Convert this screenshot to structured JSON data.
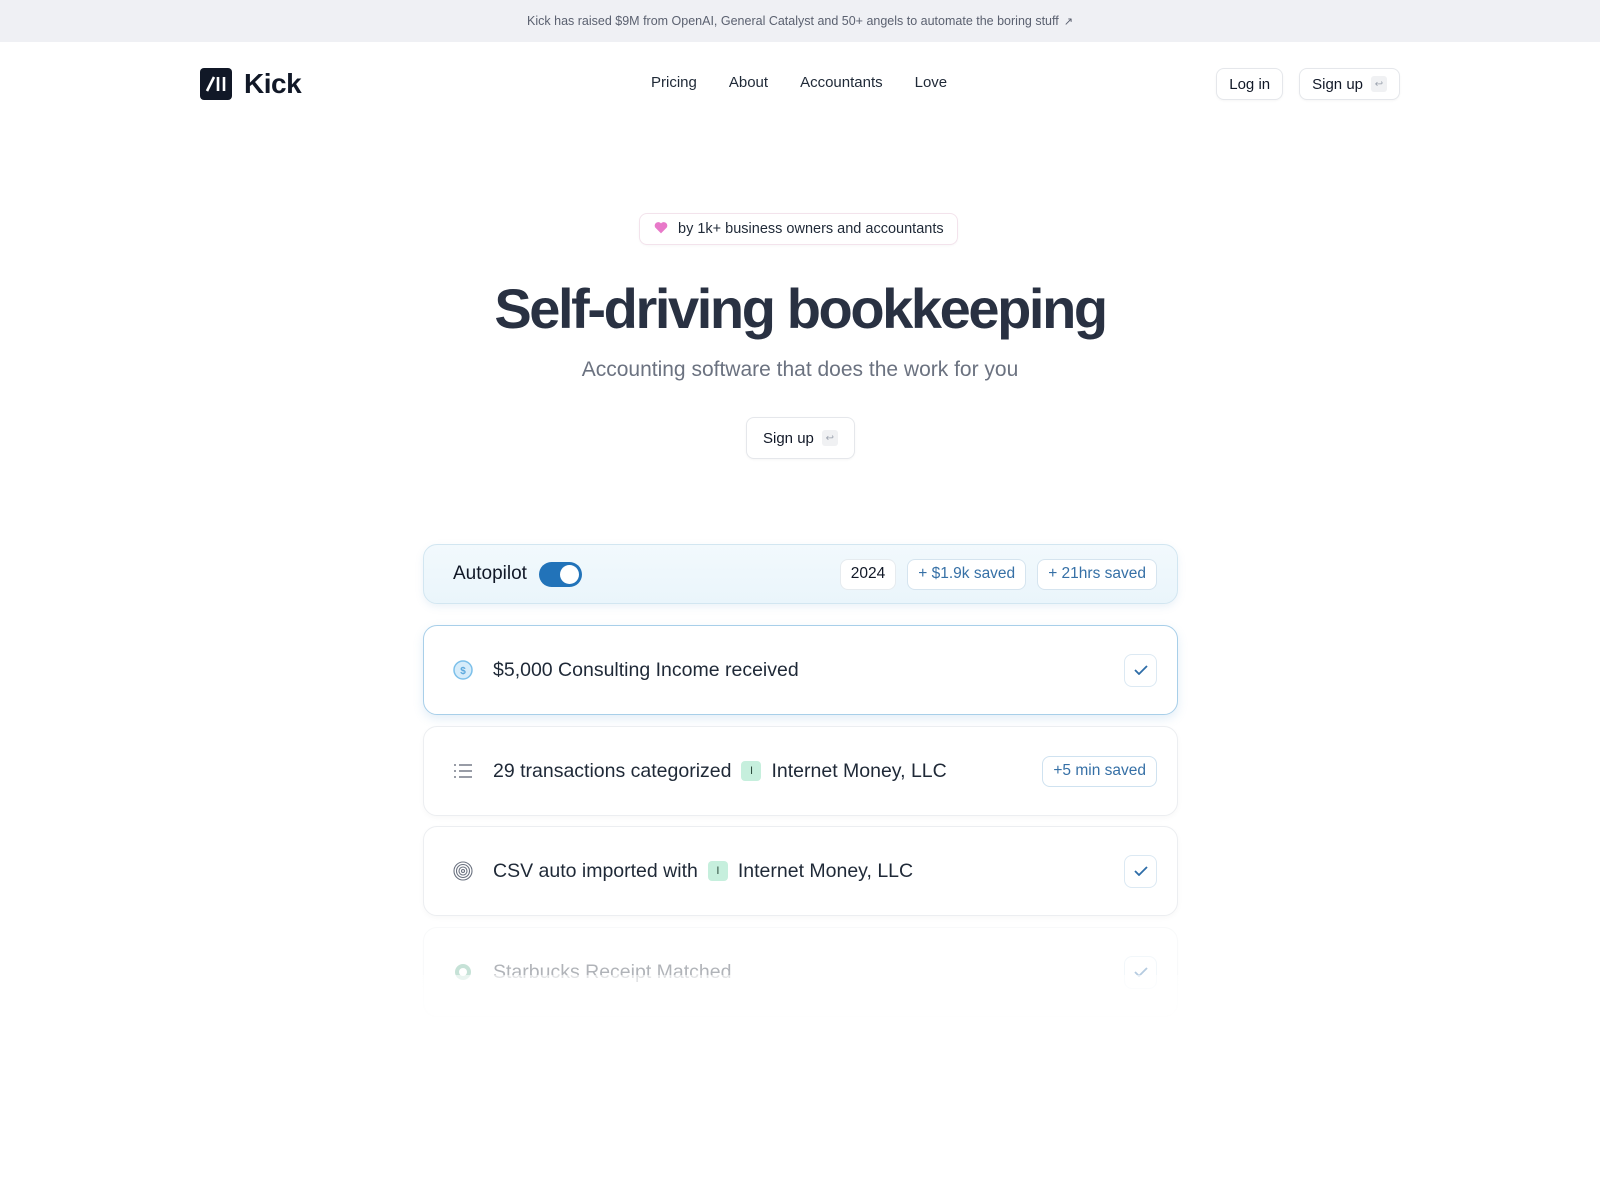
{
  "announcement": {
    "text": "Kick has raised $9M from OpenAI, General Catalyst and 50+ angels to automate the boring stuff",
    "icon": "arrow-up-right-icon",
    "arrow_glyph": "↗"
  },
  "nav": {
    "brand": "Kick",
    "links": [
      {
        "label": "Pricing"
      },
      {
        "label": "About"
      },
      {
        "label": "Accountants"
      },
      {
        "label": "Love"
      }
    ],
    "login_label": "Log in",
    "signup_label": "Sign up",
    "signup_kbd": "↩"
  },
  "hero": {
    "badge_icon": "heart-icon",
    "badge_text": "by 1k+ business owners and accountants",
    "title": "Self-driving bookkeeping",
    "subtitle": "Accounting software that does the work for you",
    "cta_label": "Sign up",
    "cta_kbd": "↩"
  },
  "colors": {
    "accent": "#2273b9",
    "heart": "#e879c9",
    "pill_text": "#3670a6",
    "company_logo_bg": "#c6efdd"
  },
  "autopilot": {
    "label": "Autopilot",
    "enabled": true,
    "year": "2024",
    "money_saved": "+ $1.9k saved",
    "time_saved": "+ 21hrs saved"
  },
  "feed": [
    {
      "icon": "dollar-circle-icon",
      "text": "$5,000 Consulting Income received",
      "status": "check-icon"
    },
    {
      "icon": "list-icon",
      "text": "29 transactions categorized",
      "company_initial": "I",
      "company": "Internet Money, LLC",
      "saved": "+5 min saved"
    },
    {
      "icon": "fingerprint-icon",
      "text": "CSV auto imported with",
      "company_initial": "I",
      "company": "Internet Money, LLC",
      "status": "check-icon"
    },
    {
      "icon": "starbucks-logo-icon",
      "text": "Starbucks Receipt Matched",
      "status": "check-icon"
    }
  ]
}
